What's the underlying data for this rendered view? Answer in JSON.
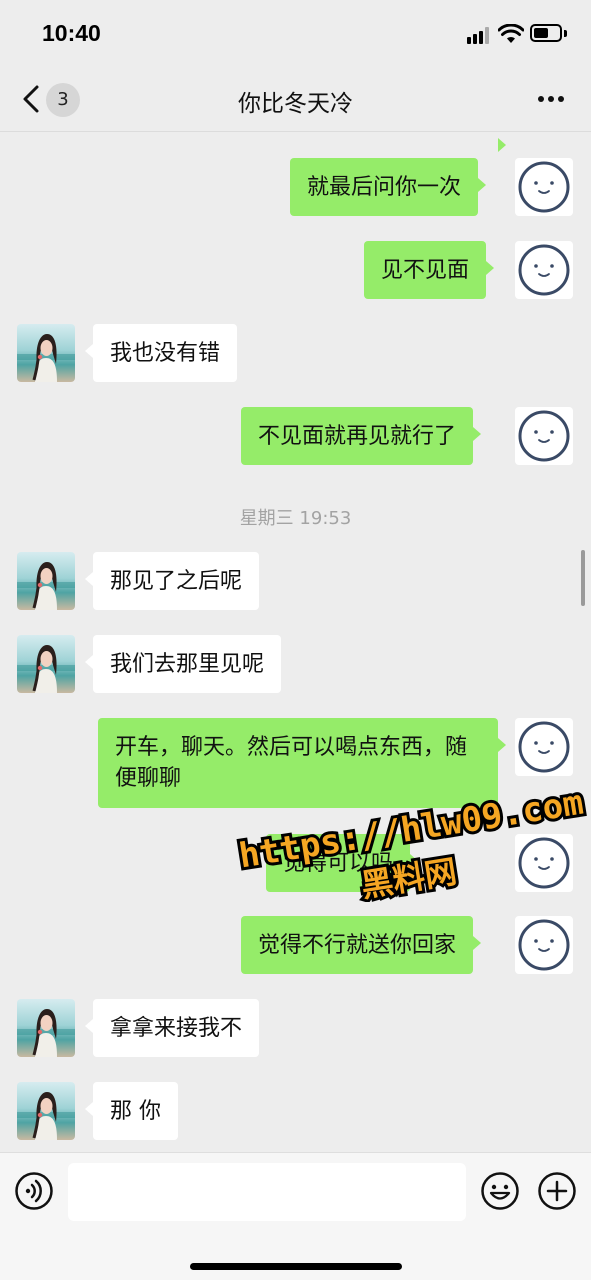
{
  "status_bar": {
    "time": "10:40"
  },
  "header": {
    "back_badge": "3",
    "title": "你比冬天冷"
  },
  "messages": [
    {
      "from": "me",
      "text": "就最后问你一次"
    },
    {
      "from": "me",
      "text": "见不见面"
    },
    {
      "from": "her",
      "text": "我也没有错"
    },
    {
      "from": "me",
      "text": "不见面就再见就行了"
    },
    {
      "from": "her",
      "text": "那见了之后呢"
    },
    {
      "from": "her",
      "text": "我们去那里见呢"
    },
    {
      "from": "me",
      "text": "开车，聊天。然后可以喝点东西，随便聊聊"
    },
    {
      "from": "me",
      "text": "觉得可以吗"
    },
    {
      "from": "me",
      "text": "觉得不行就送你回家"
    },
    {
      "from": "her",
      "text": "拿拿来接我不"
    },
    {
      "from": "her",
      "text": "那 你"
    }
  ],
  "timestamp": "星期三 19:53",
  "watermark": {
    "url": "https://hlw09.com",
    "site": "黑料网"
  },
  "input": {
    "placeholder": ""
  },
  "icons": {
    "back": "chevron-left-icon",
    "more": "more-dots-icon",
    "voice": "voice-icon",
    "emoji": "emoji-icon",
    "plus": "plus-circle-icon"
  },
  "colors": {
    "my_bubble": "#95ec69",
    "their_bubble": "#ffffff",
    "background": "#ededed",
    "watermark": "#f5a623"
  }
}
